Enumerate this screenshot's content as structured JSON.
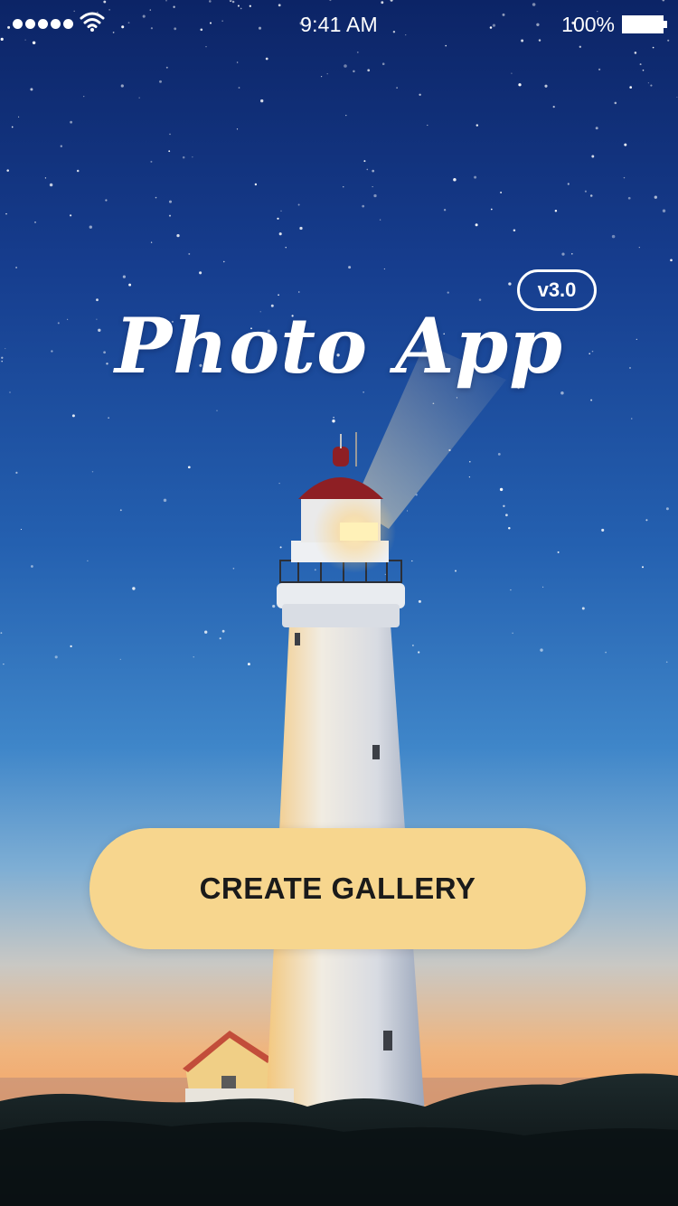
{
  "status_bar": {
    "time": "9:41 AM",
    "battery_percent": "100%",
    "signal_bars": 5,
    "signal_icon": "signal-dots-icon",
    "wifi_icon": "wifi-icon",
    "battery_icon": "battery-icon"
  },
  "hero": {
    "title": "Photo App",
    "version": "v3.0"
  },
  "actions": {
    "create_gallery_label": "CREATE GALLERY"
  },
  "colors": {
    "button_fill": "#f7d68e",
    "button_text": "#1a1a1a",
    "sky_top": "#0d2a6e",
    "sky_bottom": "#f2a66a",
    "text_light": "#ffffff"
  }
}
